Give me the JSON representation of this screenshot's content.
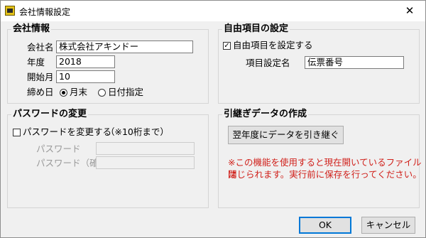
{
  "window": {
    "title": "会社情報設定",
    "close_glyph": "✕"
  },
  "company": {
    "group_title": "会社情報",
    "name_label": "会社名",
    "name_value": "株式会社アキンドー",
    "year_label": "年度",
    "year_value": "2018",
    "start_month_label": "開始月",
    "start_month_value": "10",
    "closing_label": "締め日",
    "closing_options": [
      "月末",
      "日付指定"
    ],
    "closing_selected": "月末"
  },
  "custom_field": {
    "group_title": "自由項目の設定",
    "enable_label": "自由項目を設定する",
    "enable_checked": true,
    "check_glyph": "✓",
    "name_label": "項目設定名",
    "name_value": "伝票番号"
  },
  "password": {
    "group_title": "パスワードの変更",
    "change_label": "パスワードを変更する",
    "change_checked": false,
    "note": "（※10桁まで）",
    "password_label": "パスワード",
    "password_value": "",
    "confirm_label": "パスワード（確認）",
    "confirm_value": ""
  },
  "carryover": {
    "group_title": "引継ぎデータの作成",
    "button_label": "翌年度にデータを引き継ぐ",
    "warning_line1": "※この機能を使用すると現在開いているファイルは",
    "warning_line2": "閉じられます。実行前に保存を行ってください。"
  },
  "footer": {
    "ok_label": "OK",
    "cancel_label": "キャンセル"
  },
  "colors": {
    "warning": "#d0201a",
    "default_button_border": "#0078d7"
  }
}
